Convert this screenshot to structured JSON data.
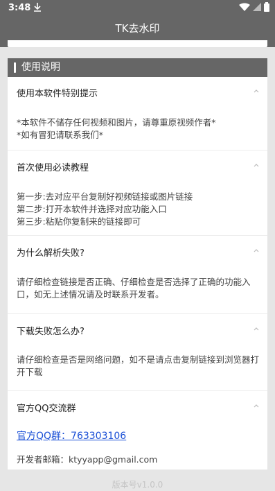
{
  "status": {
    "time": "3:48"
  },
  "app": {
    "title": "TK去水印"
  },
  "section": {
    "title": "使用说明"
  },
  "items": [
    {
      "title": "使用本软件特别提示",
      "lines": [
        "*本软件不储存任何视频和图片，请尊重原视频作者*",
        "*如有冒犯请联系我们*"
      ]
    },
    {
      "title": "首次使用必读教程",
      "lines": [
        "第一步:去对应平台复制好视频链接或图片链接",
        "第二步:打开本软件并选择对应功能入口",
        "第三步:粘贴你复制来的链接即可"
      ]
    },
    {
      "title": "为什么解析失败?",
      "lines": [
        "请仔细检查链接是否正确、仔细检查是否选择了正确的功能入口，如无上述情况请及时联系开发者。"
      ]
    },
    {
      "title": "下载失败怎么办?",
      "lines": [
        "请仔细检查是否是网络问题，如不是请点击复制链接到浏览器打开下载"
      ]
    },
    {
      "title": "官方QQ交流群",
      "qq_link": "官方QQ群：763303106",
      "email": "开发者邮箱：ktyyapp@gmail.com"
    }
  ],
  "footer": {
    "version": "版本号v1.0.0"
  },
  "colors": {
    "header": "#666666",
    "background": "#e6e6e6",
    "link": "#1a4fd6"
  }
}
